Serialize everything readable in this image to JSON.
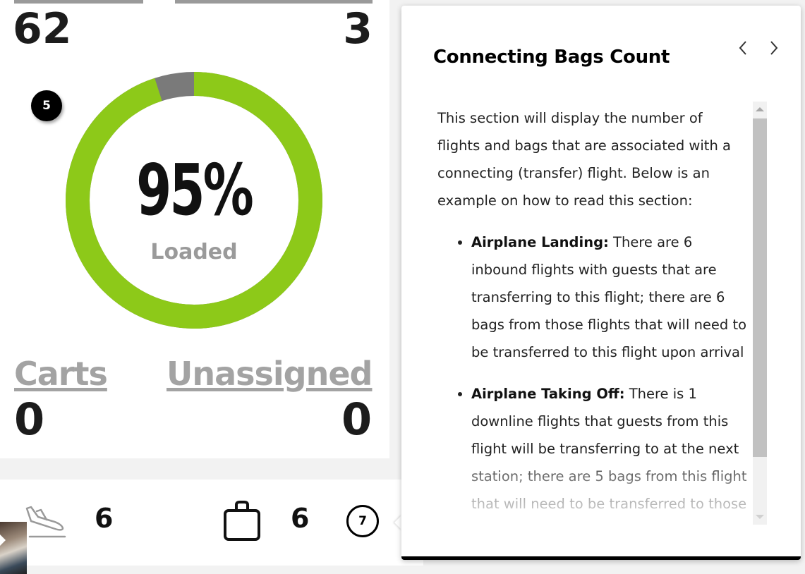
{
  "dashboard": {
    "top_left_value": "62",
    "top_right_value": "3",
    "step_badge": "5",
    "donut": {
      "percent_text": "95%",
      "label": "Loaded",
      "loaded_fraction": 0.95,
      "loaded_color": "#8dc919",
      "remaining_color": "#7a7a7a"
    },
    "carts_label": "Carts",
    "carts_value": "0",
    "unassigned_label": "Unassigned",
    "unassigned_value": "0"
  },
  "connecting_strip": {
    "inbound_icon": "airplane-landing-icon",
    "inbound_flights": "6",
    "bag_icon": "bag-icon",
    "bags": "6",
    "step_badge": "7"
  },
  "popup": {
    "title": "Connecting Bags Count",
    "prev_icon": "chevron-left-icon",
    "next_icon": "chevron-right-icon",
    "intro": "This section will display the number of flights and bags that are associated with a connecting (transfer) flight. Below is an example on how to read this section:",
    "items": [
      {
        "term": "Airplane Landing:",
        "text": " There are 6 inbound flights with guests that are transferring to this flight; there are 6 bags from those flights that will need to be transferred to this flight upon arrival"
      },
      {
        "term": "Airplane Taking Off:",
        "text": " There is 1 downline flights that guests from this flight will be transferring to at the next station; there are 5 bags from this flight that will need to be transferred to those flights upon"
      }
    ]
  }
}
